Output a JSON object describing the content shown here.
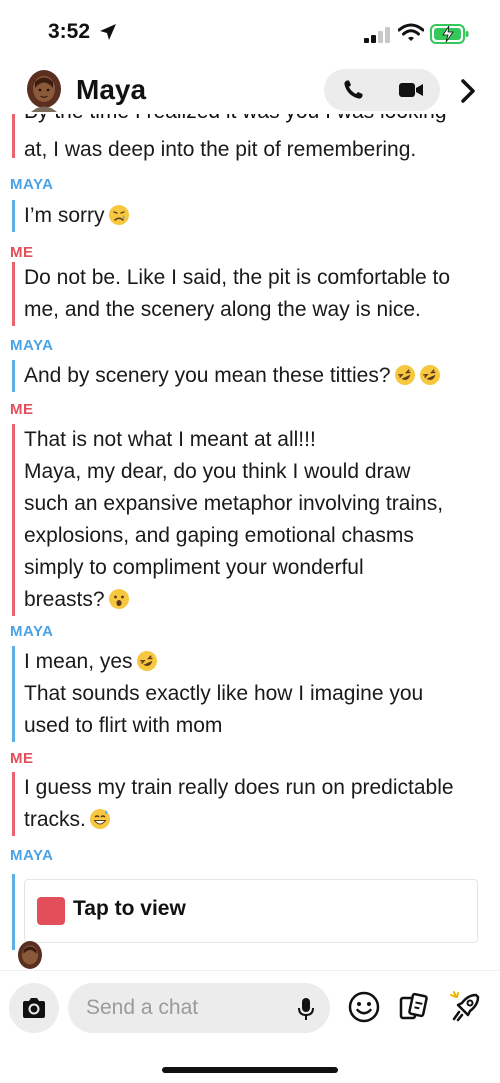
{
  "status": {
    "time": "3:52"
  },
  "header": {
    "contact_name": "Maya"
  },
  "conversation": {
    "partial_top": "By the time I realized it was you I was looking",
    "messages": [
      {
        "sender": "",
        "lines": [
          "at, I was deep into the pit of remembering."
        ]
      },
      {
        "sender": "MAYA",
        "lines": [
          "I’m sorry"
        ]
      },
      {
        "sender": "ME",
        "lines": [
          "Do not be. Like I said, the pit is comfortable to",
          "me, and the scenery along the way is nice."
        ]
      },
      {
        "sender": "MAYA",
        "lines": [
          "And by scenery you mean these titties?"
        ]
      },
      {
        "sender": "ME",
        "lines": [
          "That is not what I meant at all!!!",
          "Maya, my dear, do you think I would draw",
          "such an expansive metaphor involving trains,",
          "explosions, and gaping emotional chasms",
          "simply to compliment your wonderful",
          "breasts?"
        ]
      },
      {
        "sender": "MAYA",
        "lines": [
          "I mean, yes",
          "That sounds exactly like how I imagine you",
          "used to flirt with mom"
        ]
      },
      {
        "sender": "ME",
        "lines": [
          "I guess my train really does run on predictable",
          "tracks."
        ]
      },
      {
        "sender": "MAYA",
        "snap": "Tap to view"
      }
    ]
  },
  "composer": {
    "placeholder": "Send a chat"
  },
  "colors": {
    "maya": "#4aa3e6",
    "me": "#e24f5a",
    "snap": "#e24f5a"
  },
  "icons": [
    "location-arrow-icon",
    "signal-icon",
    "wifi-icon",
    "battery-charging-icon",
    "phone-icon",
    "video-icon",
    "chevron-right-icon",
    "camera-icon",
    "mic-icon",
    "smiley-icon",
    "cards-icon",
    "rocket-icon"
  ]
}
